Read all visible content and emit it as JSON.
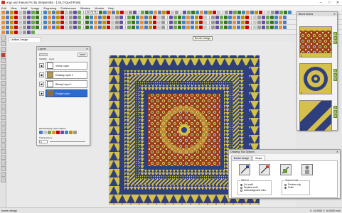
{
  "window": {
    "title": "argo and Hanan Pro by Stelpyrstiso - [ SILO Quell Poss]",
    "controls": {
      "minimize": "–",
      "maximize": "□",
      "close": "✕"
    }
  },
  "menu": [
    "Edit",
    "View",
    "Motif",
    "Image",
    "Engraving",
    "Preferences",
    "Window",
    "Module",
    "Help"
  ],
  "toolbar": {
    "zoom_value": "32.74 %"
  },
  "document_tab": "Untitled Design",
  "tooltip": "Border design",
  "layers_panel": {
    "title": "Layers",
    "close": "✕",
    "col_visibility": "Visibility",
    "col_layer": "Layer",
    "new_button": "Invert",
    "layers": [
      {
        "name": "Vector Layer",
        "thumb": "#ffffff",
        "selected": false
      },
      {
        "name": "Drawing Layer 2",
        "thumb": "#b39a4e",
        "selected": false
      },
      {
        "name": "Bitmap Layer 1",
        "thumb": "#ffffff",
        "selected": false
      },
      {
        "name": "Design Layer",
        "thumb": "#8a6d3b",
        "selected": true
      }
    ],
    "options_label": "Motif Drawing Layer Options",
    "transparency_label": "Transparency",
    "transparency_value": "0"
  },
  "blend_panel": {
    "title": "Blend Boxes",
    "close": "✕",
    "items": [
      {
        "num": "1"
      },
      {
        "num": "2"
      },
      {
        "num": "3"
      }
    ]
  },
  "drawing_tool_options": {
    "title": "Drawing Tool Options",
    "close": "✕",
    "tabs": [
      "Border design",
      "Shape"
    ],
    "method_title": "Method",
    "methods": [
      "Cut motif",
      "Replace motif",
      "Add background color"
    ],
    "output_title": "Output mode",
    "outputs": [
      "Preview only",
      "Scale"
    ]
  },
  "status": {
    "left": "border design",
    "right": "X: 14.0000 Y: 16.0000 Inch"
  },
  "colors": {
    "navy": "#2f3f7e",
    "gold": "#d4c04a",
    "bg": "#e9e9e9",
    "selected": "#2d6bd0"
  },
  "icons": [
    "app-icon",
    "eye-icon",
    "close-icon",
    "minimize-icon",
    "maximize-icon",
    "scissors-icon",
    "replace-icon",
    "fill-icon"
  ]
}
